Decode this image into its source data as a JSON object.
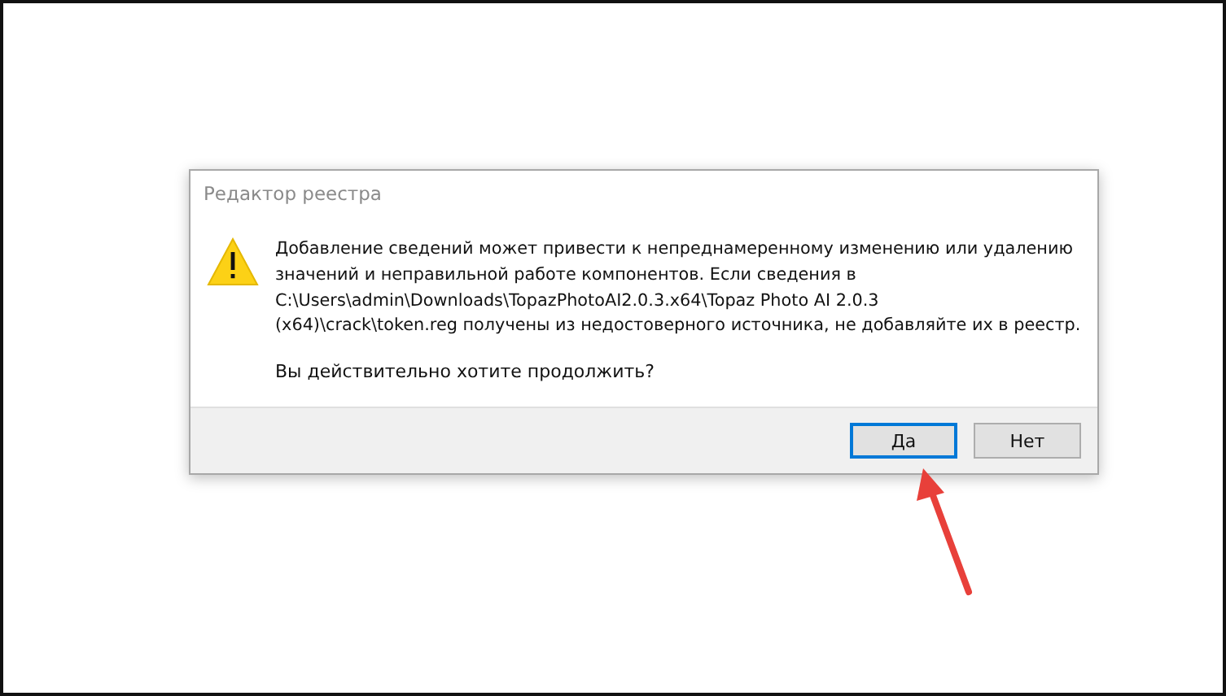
{
  "dialog": {
    "title": "Редактор реестра",
    "message_lines": [
      "Добавление сведений может привести к непреднамеренному изменению или удалению",
      "значений и неправильной работе компонентов. Если сведения в",
      "C:\\Users\\admin\\Downloads\\TopazPhotoAI2.0.3.x64\\Topaz Photo AI 2.0.3",
      "(x64)\\crack\\token.reg получены из недостоверного источника, не добавляйте их в реестр."
    ],
    "question": "Вы действительно хотите продолжить?",
    "buttons": [
      {
        "label": "Да",
        "selected": true
      },
      {
        "label": "Нет",
        "selected": false
      }
    ]
  },
  "annotation": {
    "kind": "arrow"
  }
}
